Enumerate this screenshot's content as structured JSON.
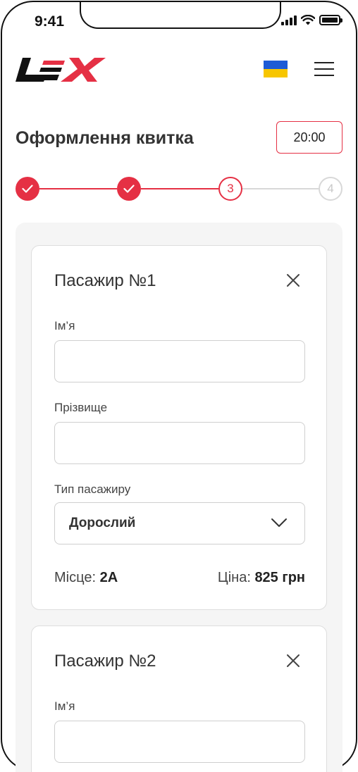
{
  "status_bar": {
    "time": "9:41"
  },
  "header": {
    "logo_alt": "LEX",
    "flag_icon": "ukraine-flag-icon",
    "menu_icon": "hamburger-menu-icon"
  },
  "page": {
    "title": "Оформлення квитка",
    "timer": "20:00"
  },
  "stepper": {
    "steps": [
      {
        "label": "",
        "state": "done"
      },
      {
        "label": "",
        "state": "done"
      },
      {
        "label": "3",
        "state": "active"
      },
      {
        "label": "4",
        "state": "pending"
      }
    ]
  },
  "passengers": [
    {
      "title": "Пасажир №1",
      "first_name_label": "Ім’я",
      "first_name_value": "",
      "last_name_label": "Прізвище",
      "last_name_value": "",
      "type_label": "Тип пасажиру",
      "type_value": "Дорослий",
      "seat_label": "Місце: ",
      "seat_value": "2А",
      "price_label": "Ціна: ",
      "price_value": "825 грн"
    },
    {
      "title": "Пасажир №2",
      "first_name_label": "Ім’я",
      "first_name_value": ""
    }
  ],
  "colors": {
    "accent": "#e53044",
    "flag_blue": "#1e5bd6",
    "flag_yellow": "#f7c600",
    "panel_bg": "#f5f5f5"
  }
}
